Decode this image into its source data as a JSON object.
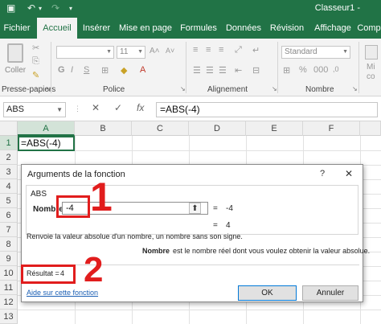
{
  "app": {
    "window_title": "Classeur1 -",
    "accent": "#217346"
  },
  "quick_access": {
    "save_icon": "save-icon",
    "undo_icon": "undo-icon",
    "redo_icon": "redo-icon"
  },
  "ribbon": {
    "tabs": [
      {
        "label": "Fichier"
      },
      {
        "label": "Accueil"
      },
      {
        "label": "Insérer"
      },
      {
        "label": "Mise en page"
      },
      {
        "label": "Formules"
      },
      {
        "label": "Données"
      },
      {
        "label": "Révision"
      },
      {
        "label": "Affichage"
      },
      {
        "label": "Comp"
      }
    ],
    "active_tab": "Accueil",
    "clipboard": {
      "paste_label": "Coller",
      "group_label": "Presse-papiers"
    },
    "font": {
      "size_value": "11",
      "group_label": "Police"
    },
    "alignment": {
      "group_label": "Alignement"
    },
    "number": {
      "format_value": "Standard",
      "group_label": "Nombre"
    },
    "extra": {
      "label_a": "Mi",
      "label_b": "co"
    }
  },
  "formula_bar": {
    "name_box": "ABS",
    "cancel_symbol": "✕",
    "enter_symbol": "✓",
    "fx_label": "fx",
    "formula": "=ABS(-4)"
  },
  "grid": {
    "columns": [
      "A",
      "B",
      "C",
      "D",
      "E",
      "F"
    ],
    "rows": [
      "1",
      "2",
      "3",
      "4",
      "5",
      "6",
      "7",
      "8",
      "9",
      "10",
      "11",
      "12",
      "13"
    ],
    "cell_a1": "=ABS(-4)"
  },
  "dialog": {
    "title": "Arguments de la fonction",
    "help": "?",
    "close": "✕",
    "function_name": "ABS",
    "argument_label": "Nombre",
    "argument_value": "-4",
    "argument_equals": "=",
    "argument_result": "-4",
    "function_equals": "=",
    "function_result": "4",
    "description": "Renvoie la valeur absolue d'un nombre, un nombre sans son signe.",
    "arg_help_name": "Nombre",
    "arg_help_text": "est le nombre réel dont vous voulez obtenir la valeur absolue.",
    "result_label": "Résultat =",
    "result_value": "4",
    "help_link": "Aide sur cette fonction",
    "ok_label": "OK",
    "cancel_label": "Annuler"
  },
  "annotations": {
    "marker_1": "1",
    "marker_2": "2",
    "color": "#e11d1d"
  }
}
